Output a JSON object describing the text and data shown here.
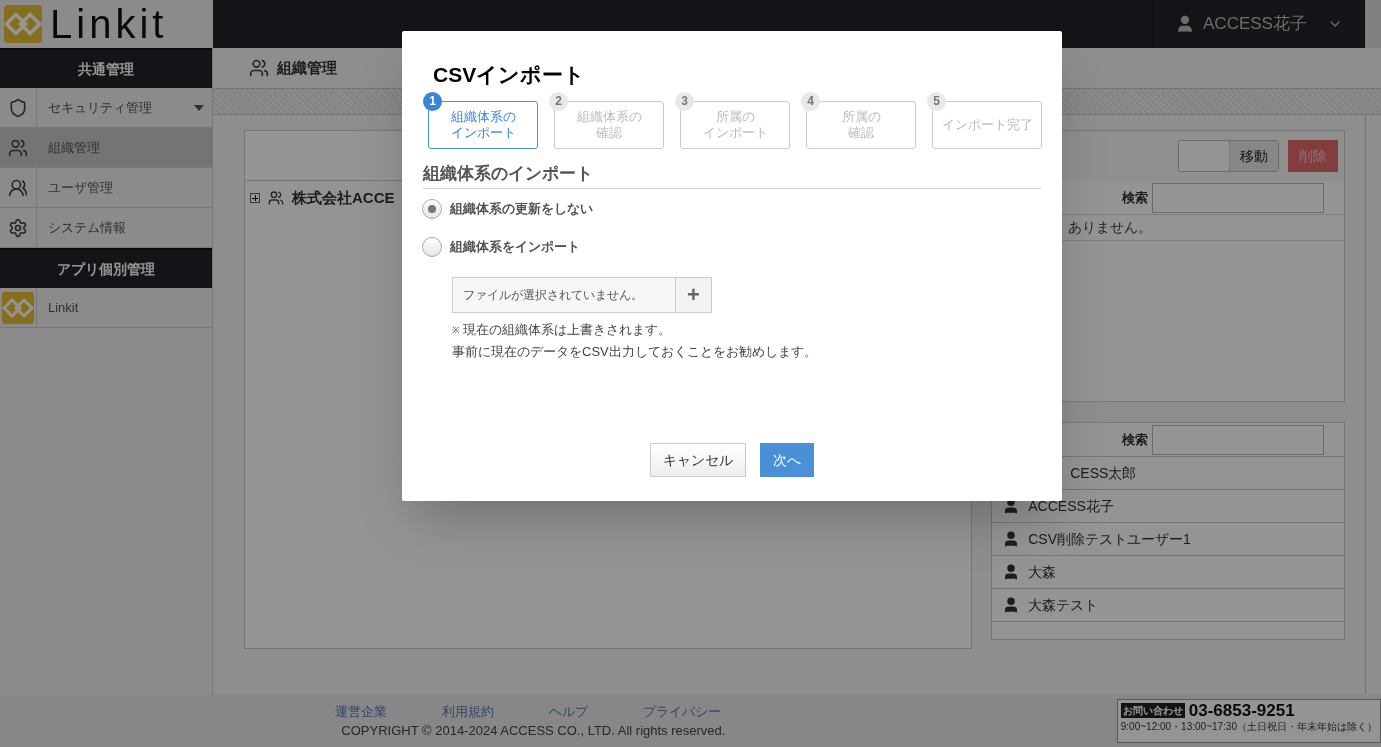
{
  "header": {
    "logo_text": "Linkit",
    "user": "ACCESS花子"
  },
  "sidebar": {
    "sections": [
      {
        "title": "共通管理",
        "items": [
          {
            "label": "セキュリティ管理",
            "selected": false,
            "expanded": false
          },
          {
            "label": "組織管理",
            "selected": true
          },
          {
            "label": "ユーザ管理",
            "selected": false
          },
          {
            "label": "システム情報",
            "selected": false
          }
        ]
      },
      {
        "title": "アプリ個別管理",
        "items": [
          {
            "label": "Linkit",
            "selected": false
          }
        ]
      }
    ]
  },
  "page": {
    "title": "組織管理"
  },
  "tree": {
    "nodes": [
      {
        "label": "株式会社ACCE",
        "expanded": false
      }
    ]
  },
  "group_panel": {
    "move_button": "移動",
    "delete_button": "削除",
    "search_label": "検索",
    "message": "ありません。"
  },
  "user_panel": {
    "search_label": "検索",
    "users": [
      "CESS太郎",
      "ACCESS花子",
      "CSV削除テストユーザー1",
      "大森",
      "大森テスト"
    ]
  },
  "footer": {
    "links": [
      "運営企業",
      "利用規約",
      "ヘルプ",
      "プライバシー"
    ],
    "copyright": "COPYRIGHT © 2014-2024 ACCESS CO., LTD. All rights reserved.",
    "contact_badge": "お問い合わせ",
    "phone": "03-6853-9251",
    "hours": "9:00~12:00・13:00~17:30（土日祝日・年末年始は除く）"
  },
  "dialog": {
    "title": "CSVインポート",
    "steps": [
      {
        "number": "1",
        "lines": [
          "組織体系の",
          "インポート"
        ],
        "selected": true
      },
      {
        "number": "2",
        "lines": [
          "組織体系の",
          "確認"
        ],
        "selected": false
      },
      {
        "number": "3",
        "lines": [
          "所属の",
          "インポート"
        ],
        "selected": false
      },
      {
        "number": "4",
        "lines": [
          "所属の",
          "確認"
        ],
        "selected": false
      },
      {
        "number": "5",
        "lines": [
          "インポート完了"
        ],
        "selected": false
      }
    ],
    "section_title": "組織体系のインポート",
    "options": [
      {
        "label": "組織体系の更新をしない",
        "selected": true
      },
      {
        "label": "組織体系をインポート",
        "selected": false
      }
    ],
    "file_field": {
      "placeholder": "ファイルが選択されていません。",
      "add_button": "+"
    },
    "note_mark": "※",
    "note_lines": [
      "現在の組織体系は上書きされます。",
      "事前に現在のデータをCSV出力しておくことをお勧めします。"
    ],
    "buttons": {
      "cancel": "キャンセル",
      "next": "次へ"
    }
  }
}
